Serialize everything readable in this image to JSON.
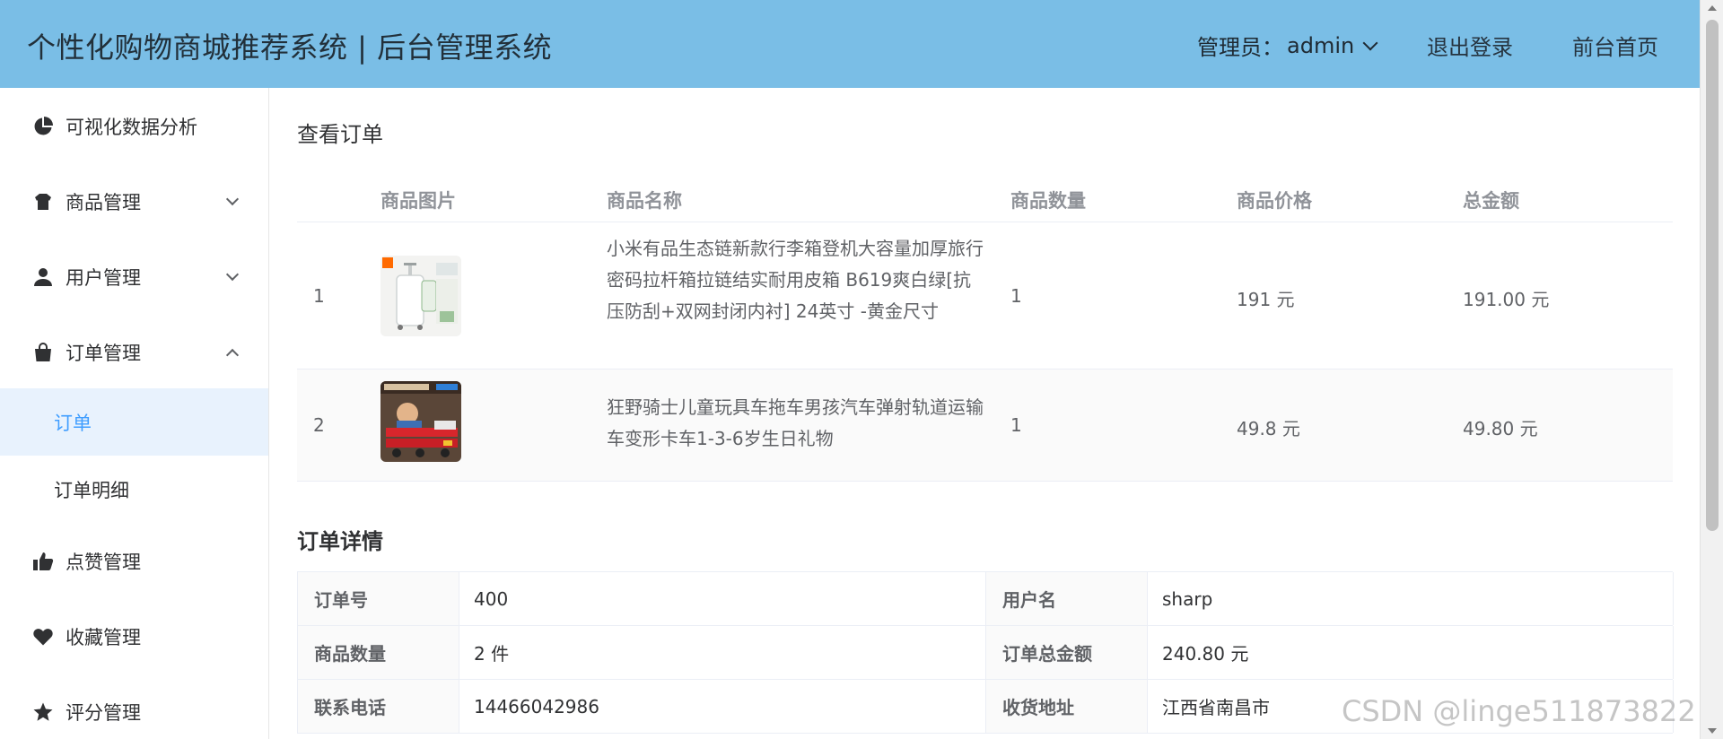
{
  "header": {
    "title": "个性化购物商城推荐系统 | 后台管理系统",
    "admin_label": "管理员：",
    "admin_name": "admin",
    "logout": "退出登录",
    "home": "前台首页"
  },
  "sidebar": {
    "items": [
      {
        "label": "可视化数据分析",
        "icon": "pie-chart-icon"
      },
      {
        "label": "商品管理",
        "icon": "product-icon"
      },
      {
        "label": "用户管理",
        "icon": "user-icon"
      },
      {
        "label": "订单管理",
        "icon": "shopping-bag-icon"
      },
      {
        "label": "订单",
        "active": true
      },
      {
        "label": "订单明细"
      },
      {
        "label": "点赞管理",
        "icon": "thumbs-up-icon"
      },
      {
        "label": "收藏管理",
        "icon": "heart-icon"
      },
      {
        "label": "评分管理",
        "icon": "star-icon"
      }
    ]
  },
  "page": {
    "title": "查看订单"
  },
  "goods_table": {
    "headers": [
      "商品图片",
      "商品名称",
      "商品数量",
      "商品价格",
      "总金额"
    ],
    "rows": [
      {
        "index": "1",
        "name": "小米有品生态链新款行李箱登机大容量加厚旅行密码拉杆箱拉链结实耐用皮箱 B619爽白绿[抗压防刮+双网封闭内衬] 24英寸 -黄金尺寸",
        "qty": "1",
        "price": "191 元",
        "total": "191.00 元",
        "image": "suitcase-image"
      },
      {
        "index": "2",
        "name": "狂野骑士儿童玩具车拖车男孩汽车弹射轨道运输车变形卡车1-3-6岁生日礼物",
        "qty": "1",
        "price": "49.8 元",
        "total": "49.80 元",
        "image": "toy-truck-image"
      }
    ]
  },
  "detail": {
    "title": "订单详情",
    "rows": [
      [
        {
          "k": "订单号",
          "v": "400"
        },
        {
          "k": "用户名",
          "v": "sharp"
        }
      ],
      [
        {
          "k": "商品数量",
          "v": "2 件"
        },
        {
          "k": "订单总金额",
          "v": "240.80 元"
        }
      ],
      [
        {
          "k": "联系电话",
          "v": "14466042986"
        },
        {
          "k": "收货地址",
          "v": "江西省南昌市"
        }
      ]
    ]
  },
  "watermark": "CSDN @linge511873822",
  "colors": {
    "header_bg": "#7abee6",
    "active_bg": "#e8f2fd",
    "active_text": "#409eff"
  }
}
